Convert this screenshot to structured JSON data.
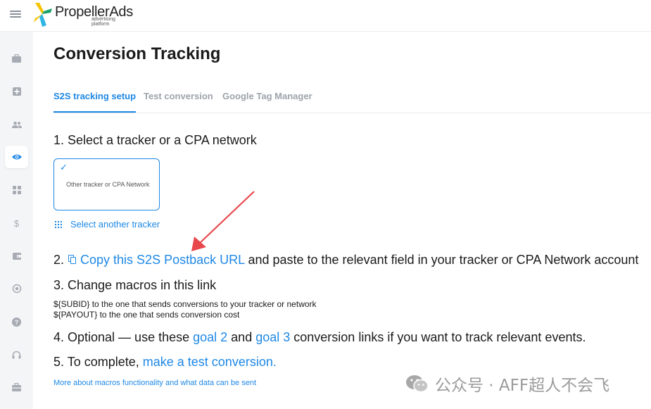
{
  "brand": {
    "name": "PropellerAds",
    "tagline": "advertising platform"
  },
  "sidebar": {
    "items": [
      {
        "name": "campaigns-icon",
        "glyph": "■"
      },
      {
        "name": "creatives-icon",
        "glyph": "✚"
      },
      {
        "name": "audiences-icon",
        "glyph": "👥"
      },
      {
        "name": "tracking-eye-icon",
        "glyph": "◉",
        "active": true
      },
      {
        "name": "dashboard-grid-icon",
        "glyph": "▦"
      },
      {
        "name": "finance-dollar-icon",
        "glyph": "$"
      },
      {
        "name": "wallet-icon",
        "glyph": "▣"
      },
      {
        "name": "referral-icon",
        "glyph": "◎"
      },
      {
        "name": "help-icon",
        "glyph": "?"
      },
      {
        "name": "support-headset-icon",
        "glyph": "☊"
      },
      {
        "name": "briefcase-icon",
        "glyph": "▤"
      }
    ]
  },
  "page": {
    "title": "Conversion Tracking"
  },
  "tabs": [
    {
      "label": "S2S tracking setup",
      "active": true
    },
    {
      "label": "Test conversion",
      "active": false
    },
    {
      "label": "Google Tag Manager",
      "active": false
    }
  ],
  "step1": {
    "heading": "1. Select a tracker or a CPA network",
    "card_label": "Other tracker or CPA Network",
    "select_another": "Select another tracker"
  },
  "step2": {
    "prefix": "2.",
    "link": "Copy this S2S Postback URL",
    "suffix": " and paste to the relevant field in your tracker or CPA Network account"
  },
  "step3": {
    "heading": "3. Change macros in this link",
    "macro_subid": "${SUBID} to the one that sends conversions to your tracker or network",
    "macro_payout": "${PAYOUT} to the one that sends conversion cost"
  },
  "step4": {
    "prefix": "4. Optional — use these ",
    "goal2": "goal 2",
    "middle": " and ",
    "goal3": "goal 3",
    "suffix": " conversion links if you want to track relevant events."
  },
  "step5": {
    "prefix": "5. To complete, ",
    "link": "make a test conversion."
  },
  "footer_link": "More about macros functionality and what data can be sent",
  "watermark": "公众号 · AFF超人不会飞",
  "colors": {
    "accent": "#1e88e5",
    "arrow": "#e8474c",
    "sidebar_bg": "#f4f5f7",
    "muted": "#9ea3ab"
  }
}
